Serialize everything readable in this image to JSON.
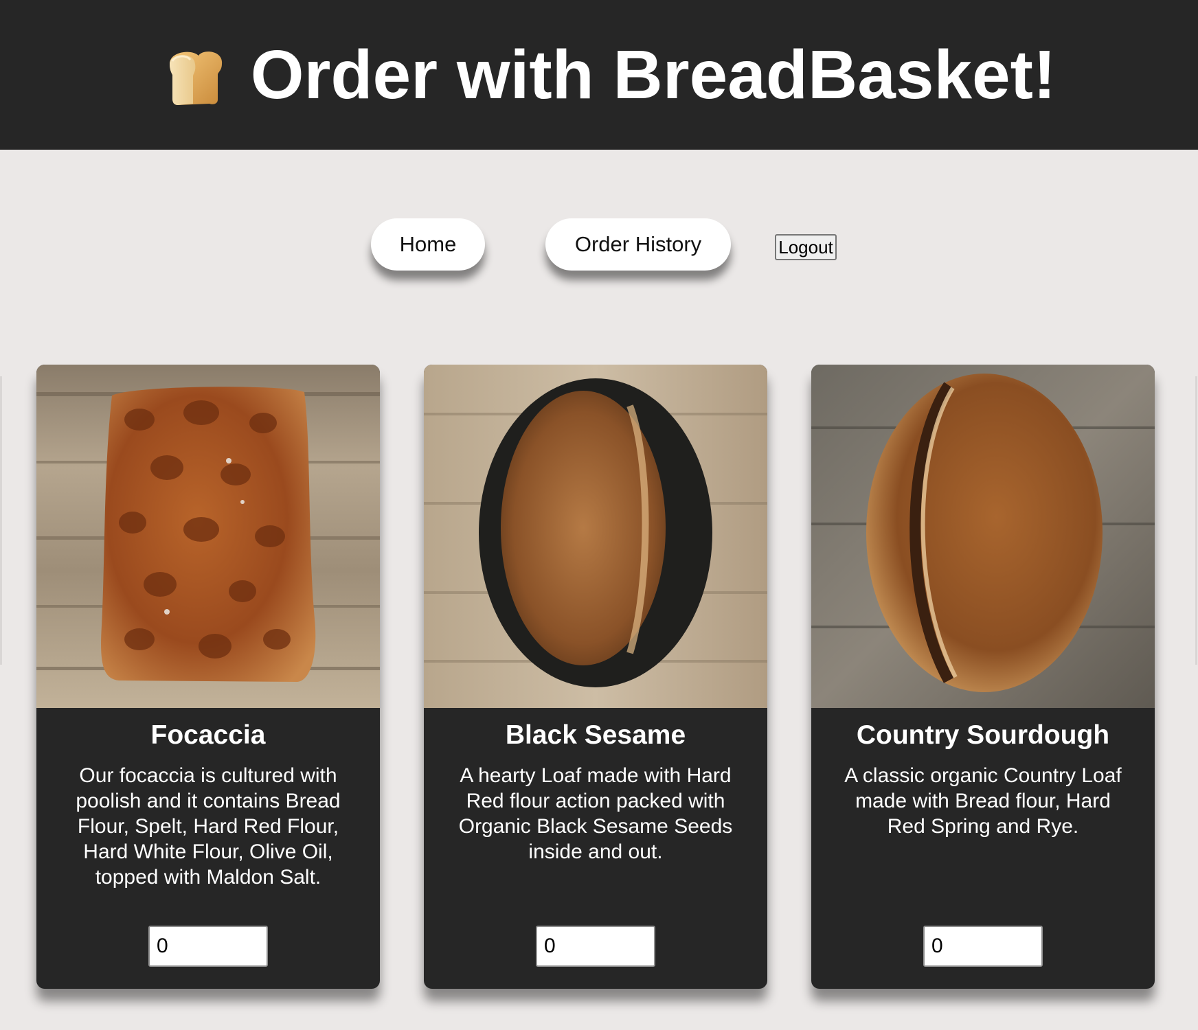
{
  "header": {
    "title": "Order with BreadBasket!",
    "icon": "bread-icon",
    "background": "#262626"
  },
  "nav": {
    "home_label": "Home",
    "order_history_label": "Order History",
    "logout_label": "Logout"
  },
  "products": [
    {
      "name": "Focaccia",
      "description": "Our focaccia is cultured with poolish and it contains Bread Flour, Spelt, Hard Red Flour, Hard White Flour, Olive Oil, topped with Maldon Salt.",
      "quantity": "0"
    },
    {
      "name": "Black Sesame",
      "description": "A hearty Loaf made with Hard Red flour action packed with Organic Black Sesame Seeds inside and out.",
      "quantity": "0"
    },
    {
      "name": "Country Sourdough",
      "description": "A classic organic Country Loaf made with Bread flour, Hard Red Spring and Rye.",
      "quantity": "0"
    }
  ],
  "colors": {
    "page_background": "#ebe8e7",
    "card_background": "#262626",
    "text_on_dark": "#ffffff"
  }
}
